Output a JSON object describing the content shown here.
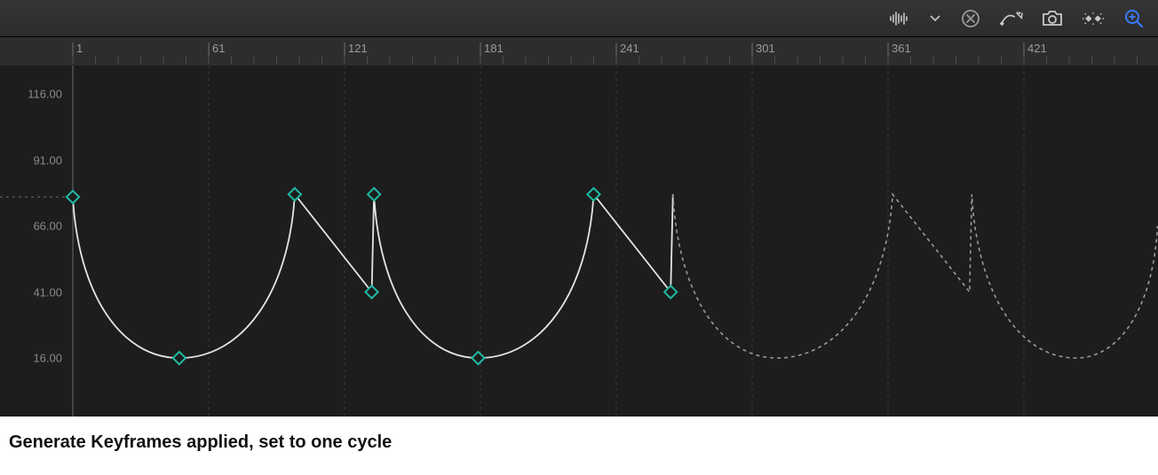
{
  "toolbar": {
    "audio_mode": "Audio waveform mode",
    "clear": "Clear curves",
    "curve_edit": "Edit curve / snapshot",
    "snapshot": "Snapshot",
    "keyframe_cluster": "Show/hide keyframes",
    "zoom": "Zoom to fit"
  },
  "ruler": {
    "ticks": [
      "1",
      "61",
      "121",
      "181",
      "241",
      "301",
      "361",
      "421"
    ]
  },
  "y_axis": {
    "labels": [
      "116.00",
      "91.00",
      "66.00",
      "41.00",
      "16.00"
    ]
  },
  "chart_data": {
    "type": "line",
    "xlabel": "",
    "ylabel": "",
    "ylim": [
      16,
      116
    ],
    "x_ticks": [
      1,
      61,
      121,
      181,
      241,
      301,
      361,
      421
    ],
    "series": [
      {
        "name": "solid-cycle",
        "style": "solid",
        "points": [
          {
            "frame": 1,
            "value": 77,
            "keyframe": true
          },
          {
            "frame": 48,
            "value": 16,
            "keyframe": true
          },
          {
            "frame": 99,
            "value": 78,
            "keyframe": true
          },
          {
            "frame": 133,
            "value": 41,
            "keyframe": true
          },
          {
            "frame": 134,
            "value": 78,
            "keyframe": true
          },
          {
            "frame": 180,
            "value": 16,
            "keyframe": true
          },
          {
            "frame": 231,
            "value": 78,
            "keyframe": true
          },
          {
            "frame": 265,
            "value": 41,
            "keyframe": true
          },
          {
            "frame": 266,
            "value": 78,
            "keyframe": false
          }
        ]
      },
      {
        "name": "dashed-extrapolation",
        "style": "dashed",
        "points": [
          {
            "frame": 266,
            "value": 78
          },
          {
            "frame": 312,
            "value": 16
          },
          {
            "frame": 363,
            "value": 78
          },
          {
            "frame": 397,
            "value": 41
          },
          {
            "frame": 398,
            "value": 78
          },
          {
            "frame": 444,
            "value": 16
          },
          {
            "frame": 480,
            "value": 66
          }
        ]
      }
    ]
  },
  "caption": "Generate Keyframes applied, set to one cycle",
  "colors": {
    "keyframe": "#1fb9a4",
    "curve": "#e4e4e4",
    "zoom_icon": "#3a7bff"
  }
}
